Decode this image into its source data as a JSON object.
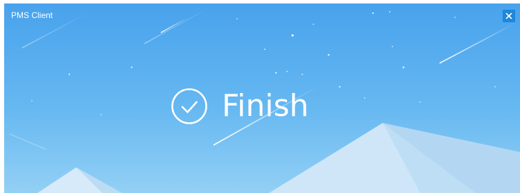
{
  "window": {
    "title": "PMS Client",
    "close_icon": "close-icon"
  },
  "status": {
    "icon": "check-circle-icon",
    "text": "Finish"
  },
  "colors": {
    "sky_top": "#4aa3ec",
    "sky_bottom": "#8ecdf5",
    "close_button_bg": "#1f86da",
    "text": "#ffffff"
  }
}
